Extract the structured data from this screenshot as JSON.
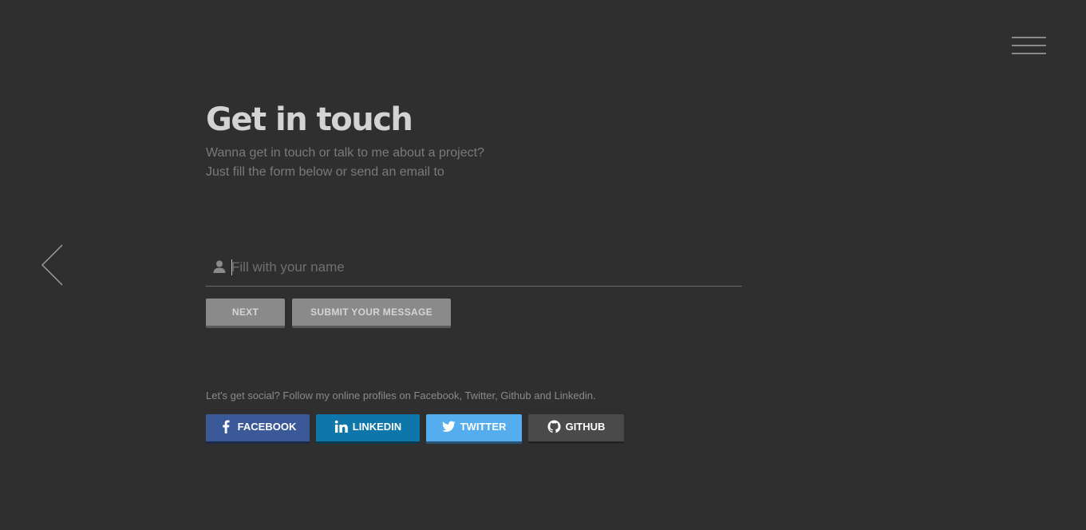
{
  "header": {
    "menu_icon": "hamburger-menu-icon"
  },
  "nav": {
    "back_icon": "chevron-left-icon"
  },
  "contact": {
    "title": "Get in touch",
    "subtitle_line1": "Wanna get in touch or talk to me about a project?",
    "subtitle_line2": "Just fill the form below or send an email to"
  },
  "form": {
    "name_placeholder": "Fill with your name",
    "name_value": "",
    "name_icon": "user-icon",
    "next_label": "NEXT",
    "submit_label": "SUBMIT YOUR MESSAGE"
  },
  "social": {
    "intro": "Let's get social? Follow my online profiles on Facebook, Twitter, Github and Linkedin.",
    "buttons": [
      {
        "label": "FACEBOOK",
        "icon": "facebook-icon",
        "color": "#3b5998"
      },
      {
        "label": "LINKEDIN",
        "icon": "linkedin-icon",
        "color": "#0e76a8"
      },
      {
        "label": "TWITTER",
        "icon": "twitter-icon",
        "color": "#55acee"
      },
      {
        "label": "GITHUB",
        "icon": "github-icon",
        "color": "#4a4a4a"
      }
    ]
  },
  "colors": {
    "background": "#2f2f2f",
    "title": "#d3d3d3",
    "muted_text": "#7a7a7a",
    "button_gray": "#8a8a8a"
  }
}
